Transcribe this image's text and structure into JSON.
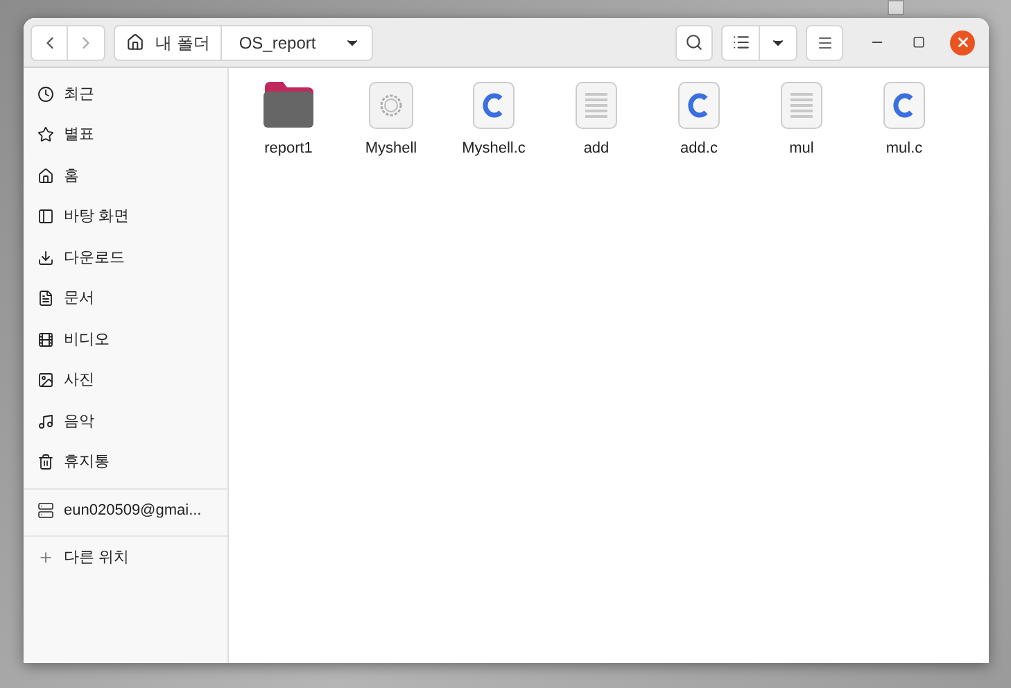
{
  "header": {
    "path": [
      {
        "kind": "home",
        "label": "내 폴더"
      },
      {
        "kind": "folder",
        "label": "OS_report"
      }
    ]
  },
  "sidebar": {
    "items": [
      {
        "kind": "recent",
        "label": "최근"
      },
      {
        "kind": "starred",
        "label": "별표"
      },
      {
        "kind": "home",
        "label": "홈"
      },
      {
        "kind": "desktop",
        "label": "바탕 화면"
      },
      {
        "kind": "download",
        "label": "다운로드"
      },
      {
        "kind": "documents",
        "label": "문서"
      },
      {
        "kind": "video",
        "label": "비디오"
      },
      {
        "kind": "pictures",
        "label": "사진"
      },
      {
        "kind": "music",
        "label": "음악"
      },
      {
        "kind": "trash",
        "label": "휴지통"
      }
    ],
    "drive": {
      "label": "eun020509@gmai..."
    },
    "other": {
      "label": "다른 위치"
    }
  },
  "files": [
    {
      "kind": "folder",
      "name": "report1"
    },
    {
      "kind": "executable",
      "name": "Myshell"
    },
    {
      "kind": "c",
      "name": "Myshell.c"
    },
    {
      "kind": "text",
      "name": "add"
    },
    {
      "kind": "c",
      "name": "add.c"
    },
    {
      "kind": "text",
      "name": "mul"
    },
    {
      "kind": "c",
      "name": "mul.c"
    }
  ]
}
